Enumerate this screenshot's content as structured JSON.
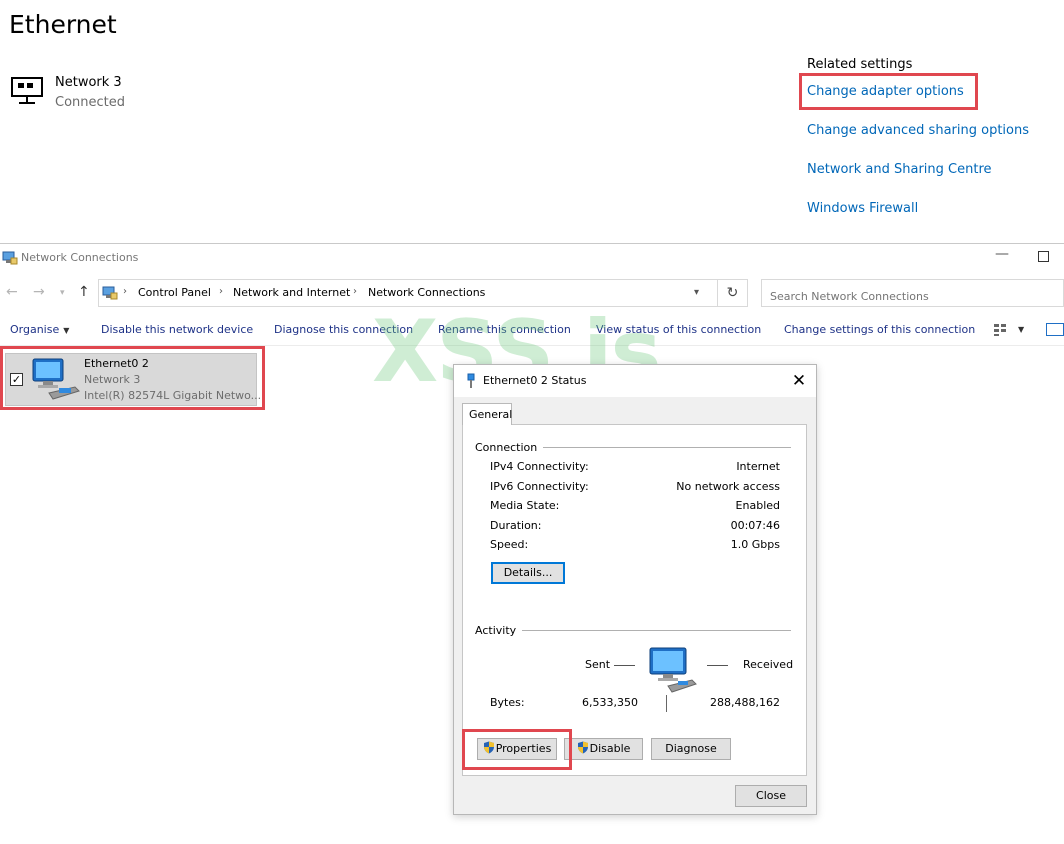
{
  "settings": {
    "title": "Ethernet",
    "network_name": "Network 3",
    "network_status": "Connected",
    "related_title": "Related settings",
    "links": [
      "Change adapter options",
      "Change advanced sharing options",
      "Network and Sharing Centre",
      "Windows Firewall"
    ]
  },
  "explorer": {
    "window_title": "Network Connections",
    "breadcrumb": [
      "Control Panel",
      "Network and Internet",
      "Network Connections"
    ],
    "search_placeholder": "Search Network Connections",
    "toolbar": {
      "organise": "Organise",
      "disable": "Disable this network device",
      "diagnose": "Diagnose this connection",
      "rename": "Rename this connection",
      "view_status": "View status of this connection",
      "change_settings": "Change settings of this connection"
    },
    "adapter": {
      "name": "Ethernet0 2",
      "network": "Network 3",
      "device": "Intel(R) 82574L Gigabit Netwo..."
    }
  },
  "watermark": "XSS.is",
  "dialog": {
    "title": "Ethernet0 2 Status",
    "tab": "General",
    "connection": {
      "label": "Connection",
      "rows": [
        {
          "key": "IPv4 Connectivity:",
          "value": "Internet"
        },
        {
          "key": "IPv6 Connectivity:",
          "value": "No network access"
        },
        {
          "key": "Media State:",
          "value": "Enabled"
        },
        {
          "key": "Duration:",
          "value": "00:07:46"
        },
        {
          "key": "Speed:",
          "value": "1.0 Gbps"
        }
      ],
      "details_button": "Details..."
    },
    "activity": {
      "label": "Activity",
      "sent_label": "Sent",
      "received_label": "Received",
      "bytes_label": "Bytes:",
      "bytes_sent": "6,533,350",
      "bytes_received": "288,488,162"
    },
    "buttons": {
      "properties": "Properties",
      "disable": "Disable",
      "diagnose": "Diagnose",
      "close": "Close"
    }
  },
  "colors": {
    "link": "#0067b8",
    "highlight": "#e0474f",
    "command": "#1e3287"
  }
}
